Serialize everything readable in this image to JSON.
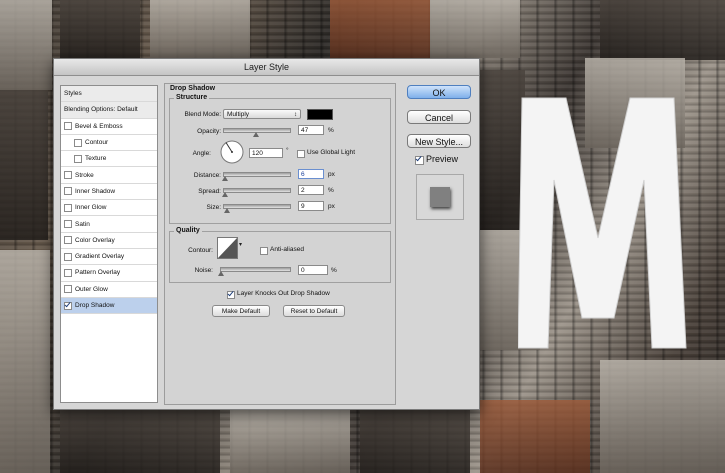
{
  "dialog": {
    "title": "Layer Style"
  },
  "styles_list": [
    {
      "label": "Styles",
      "type": "head",
      "checkbox": false,
      "checked": false
    },
    {
      "label": "Blending Options: Default",
      "type": "head",
      "checkbox": false,
      "checked": false
    },
    {
      "label": "Bevel & Emboss",
      "type": "item",
      "checkbox": true,
      "checked": false
    },
    {
      "label": "Contour",
      "type": "sub",
      "checkbox": true,
      "checked": false
    },
    {
      "label": "Texture",
      "type": "sub",
      "checkbox": true,
      "checked": false
    },
    {
      "label": "Stroke",
      "type": "item",
      "checkbox": true,
      "checked": false
    },
    {
      "label": "Inner Shadow",
      "type": "item",
      "checkbox": true,
      "checked": false
    },
    {
      "label": "Inner Glow",
      "type": "item",
      "checkbox": true,
      "checked": false
    },
    {
      "label": "Satin",
      "type": "item",
      "checkbox": true,
      "checked": false
    },
    {
      "label": "Color Overlay",
      "type": "item",
      "checkbox": true,
      "checked": false
    },
    {
      "label": "Gradient Overlay",
      "type": "item",
      "checkbox": true,
      "checked": false
    },
    {
      "label": "Pattern Overlay",
      "type": "item",
      "checkbox": true,
      "checked": false
    },
    {
      "label": "Outer Glow",
      "type": "item",
      "checkbox": true,
      "checked": false
    },
    {
      "label": "Drop Shadow",
      "type": "item",
      "checkbox": true,
      "checked": true,
      "selected": true
    }
  ],
  "drop_shadow": {
    "title": "Drop Shadow",
    "structure": {
      "title": "Structure",
      "blend_mode_label": "Blend Mode:",
      "blend_mode_value": "Multiply",
      "shadow_color": "#000000",
      "opacity_label": "Opacity:",
      "opacity_value": "47",
      "opacity_unit": "%",
      "opacity_level": 0.47,
      "angle_label": "Angle:",
      "angle_value": "120",
      "angle_unit": "°",
      "use_global_light_label": "Use Global Light",
      "use_global_light_checked": false,
      "distance_label": "Distance:",
      "distance_value": "6",
      "distance_unit": "px",
      "distance_level": 0.02,
      "spread_label": "Spread:",
      "spread_value": "2",
      "spread_unit": "%",
      "spread_level": 0.02,
      "size_label": "Size:",
      "size_value": "9",
      "size_unit": "px",
      "size_level": 0.04
    },
    "quality": {
      "title": "Quality",
      "contour_label": "Contour:",
      "anti_aliased_label": "Anti-aliased",
      "anti_aliased_checked": false,
      "noise_label": "Noise:",
      "noise_value": "0",
      "noise_unit": "%",
      "noise_level": 0.0
    },
    "knockout_label": "Layer Knocks Out Drop Shadow",
    "knockout_checked": true,
    "make_default_label": "Make Default",
    "reset_default_label": "Reset to Default"
  },
  "buttons": {
    "ok": "OK",
    "cancel": "Cancel",
    "new_style": "New Style...",
    "preview_label": "Preview",
    "preview_checked": true
  },
  "background": {
    "letter": "M"
  }
}
